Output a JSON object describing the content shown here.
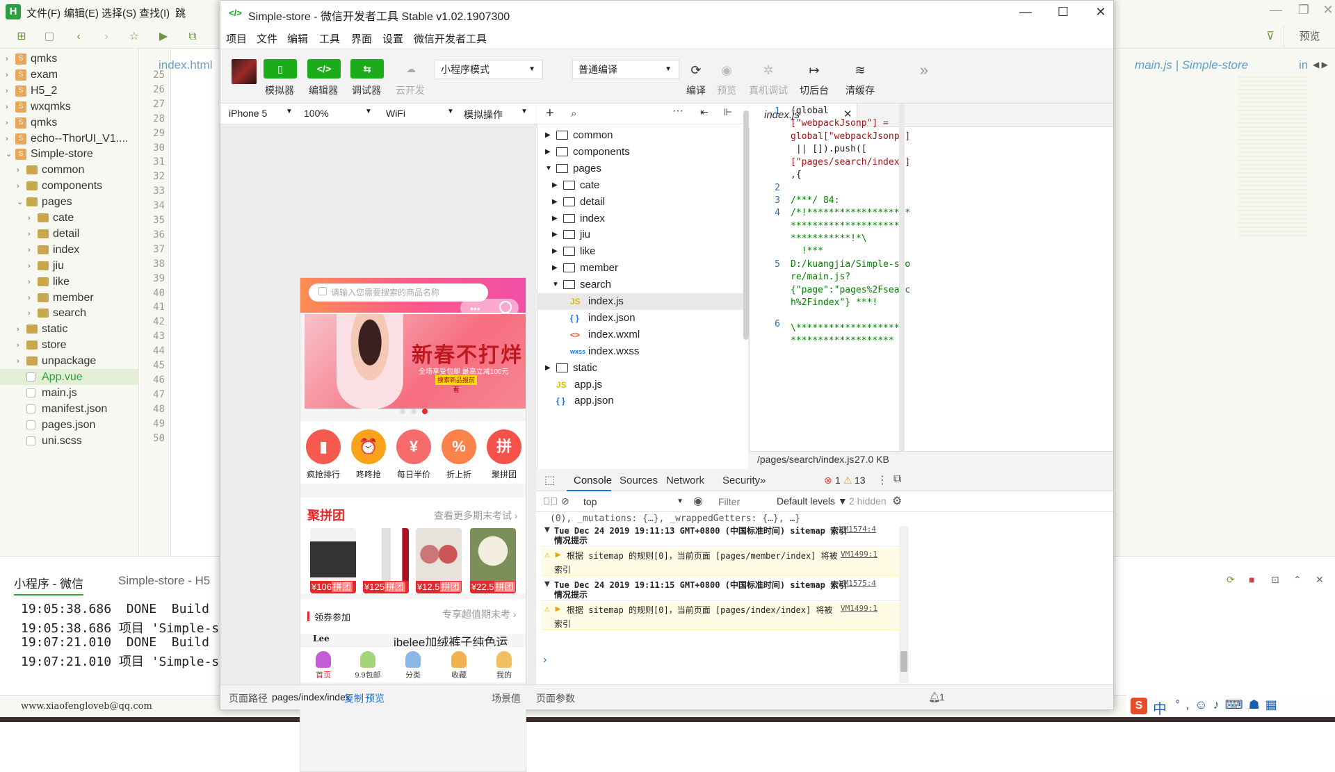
{
  "hbuilder": {
    "menus": [
      "文件(F)",
      "编辑(E)",
      "选择(S)",
      "查找(I)",
      "跳"
    ],
    "preview_label": "预览",
    "tab_index": "index.html",
    "right_tab": "main.js | Simple-store",
    "right_tab_extra": "in",
    "tree": [
      {
        "label": "qmks",
        "level": 0,
        "type": "project",
        "expanded": false
      },
      {
        "label": "exam",
        "level": 0,
        "type": "project",
        "expanded": false
      },
      {
        "label": "H5_2",
        "level": 0,
        "type": "project",
        "expanded": false
      },
      {
        "label": "wxqmks",
        "level": 0,
        "type": "project",
        "expanded": false
      },
      {
        "label": "qmks",
        "level": 0,
        "type": "project",
        "expanded": false
      },
      {
        "label": "echo--ThorUI_V1....",
        "level": 0,
        "type": "project",
        "expanded": false
      },
      {
        "label": "Simple-store",
        "level": 0,
        "type": "project",
        "expanded": true
      },
      {
        "label": "common",
        "level": 1,
        "type": "folder",
        "expanded": false
      },
      {
        "label": "components",
        "level": 1,
        "type": "folder",
        "expanded": false
      },
      {
        "label": "pages",
        "level": 1,
        "type": "folder",
        "expanded": true
      },
      {
        "label": "cate",
        "level": 2,
        "type": "folder",
        "expanded": false
      },
      {
        "label": "detail",
        "level": 2,
        "type": "folder",
        "expanded": false
      },
      {
        "label": "index",
        "level": 2,
        "type": "folder",
        "expanded": false
      },
      {
        "label": "jiu",
        "level": 2,
        "type": "folder",
        "expanded": false
      },
      {
        "label": "like",
        "level": 2,
        "type": "folder",
        "expanded": false
      },
      {
        "label": "member",
        "level": 2,
        "type": "folder",
        "expanded": false
      },
      {
        "label": "search",
        "level": 2,
        "type": "folder",
        "expanded": false
      },
      {
        "label": "static",
        "level": 1,
        "type": "folder",
        "expanded": false
      },
      {
        "label": "store",
        "level": 1,
        "type": "folder",
        "expanded": false
      },
      {
        "label": "unpackage",
        "level": 1,
        "type": "folder",
        "expanded": false
      },
      {
        "label": "App.vue",
        "level": 1,
        "type": "file",
        "selected": true
      },
      {
        "label": "main.js",
        "level": 1,
        "type": "file"
      },
      {
        "label": "manifest.json",
        "level": 1,
        "type": "file"
      },
      {
        "label": "pages.json",
        "level": 1,
        "type": "file"
      },
      {
        "label": "uni.scss",
        "level": 1,
        "type": "file"
      }
    ],
    "line_numbers": [
      "25",
      "26",
      "27",
      "28",
      "29",
      "30",
      "31",
      "32",
      "33",
      "34",
      "35",
      "36",
      "37",
      "38",
      "39",
      "40",
      "41",
      "42",
      "43",
      "44",
      "45",
      "46",
      "47",
      "48",
      "49",
      "50"
    ],
    "console_tabs": [
      "小程序 - 微信",
      "Simple-store - H5"
    ],
    "console_lines": [
      "19:05:38.686  DONE  Build",
      "19:05:38.686 项目 'Simple-s",
      "19:07:21.010  DONE  Build",
      "19:07:21.010 项目 'Simple-s"
    ],
    "status_email": "www.xiaofengloveb@qq.com"
  },
  "wechat": {
    "title": "Simple-store - 微信开发者工具 Stable v1.02.1907300",
    "menus": [
      "项目",
      "文件",
      "编辑",
      "工具",
      "界面",
      "设置",
      "微信开发者工具"
    ],
    "toolbar": {
      "simulator": "模拟器",
      "editor": "编辑器",
      "debugger": "调试器",
      "cloud": "云开发",
      "mode_select": "小程序模式",
      "compile_select": "普通编译",
      "compile": "编译",
      "preview": "预览",
      "remote_debug": "真机调试",
      "background": "切后台",
      "clear_cache": "清缓存",
      "simulator_icon_text": "▯",
      "editor_icon_text": "</>",
      "debugger_icon_text": "⇆"
    },
    "sim_bar": {
      "device": "iPhone 5",
      "zoom": "100%",
      "network": "WiFi",
      "operation": "模拟操作"
    },
    "phone": {
      "search_placeholder": "请输入您需要搜索的商品名称",
      "banner_title": "新春不打烊",
      "banner_sub": "全场享受包邮 最高立减100元",
      "banner_btn": "搜索新品报前看",
      "categories": [
        {
          "label": "疯抢排行",
          "glyph": "▮",
          "color": "#f55a4e"
        },
        {
          "label": "咚咚抢",
          "glyph": "⏰",
          "color": "#f9a21a"
        },
        {
          "label": "每日半价",
          "glyph": "¥",
          "color": "#f66b6b"
        },
        {
          "label": "折上折",
          "glyph": "%",
          "color": "#f9834a"
        },
        {
          "label": "聚拼团",
          "glyph": "拼",
          "color": "#f5524a"
        }
      ],
      "group_title": "聚拼团",
      "group_more": "查看更多期末考试 ›",
      "products": [
        {
          "price": "¥106",
          "tag": "拼团"
        },
        {
          "price": "¥125",
          "tag": "拼团"
        },
        {
          "price": "¥12.5",
          "tag": "拼团"
        },
        {
          "price": "¥22.5",
          "tag": "拼团"
        }
      ],
      "coupon_title": "领券参加",
      "coupon_more": "专享超值期末考 ›",
      "item_title": "ibelee加绒裤子纯色运",
      "tabbar": [
        "首页",
        "9.9包邮",
        "分类",
        "收藏",
        "我的"
      ]
    },
    "path_bar": {
      "label": "页面路径",
      "path": "pages/index/index",
      "copy": "复制",
      "preview": "预览",
      "scene": "场景值",
      "params": "页面参数"
    },
    "file_tree": [
      {
        "label": "common",
        "level": 0,
        "type": "folder",
        "expanded": false
      },
      {
        "label": "components",
        "level": 0,
        "type": "folder",
        "expanded": false
      },
      {
        "label": "pages",
        "level": 0,
        "type": "folder",
        "expanded": true
      },
      {
        "label": "cate",
        "level": 1,
        "type": "folder",
        "expanded": false
      },
      {
        "label": "detail",
        "level": 1,
        "type": "folder",
        "expanded": false
      },
      {
        "label": "index",
        "level": 1,
        "type": "folder",
        "expanded": false
      },
      {
        "label": "jiu",
        "level": 1,
        "type": "folder",
        "expanded": false
      },
      {
        "label": "like",
        "level": 1,
        "type": "folder",
        "expanded": false
      },
      {
        "label": "member",
        "level": 1,
        "type": "folder",
        "expanded": false
      },
      {
        "label": "search",
        "level": 1,
        "type": "folder",
        "expanded": true
      },
      {
        "label": "index.js",
        "level": 2,
        "type": "js",
        "selected": true
      },
      {
        "label": "index.json",
        "level": 2,
        "type": "json"
      },
      {
        "label": "index.wxml",
        "level": 2,
        "type": "wxml"
      },
      {
        "label": "index.wxss",
        "level": 2,
        "type": "wxss"
      },
      {
        "label": "static",
        "level": 0,
        "type": "folder",
        "expanded": false
      },
      {
        "label": "app.js",
        "level": 0,
        "type": "js"
      },
      {
        "label": "app.json",
        "level": 0,
        "type": "json"
      }
    ],
    "editor": {
      "tab": "index.js",
      "file_path": "/pages/search/index.js",
      "file_size": "27.0 KB",
      "line_numbers": [
        "1",
        "2",
        "3",
        "4",
        "5",
        "6"
      ],
      "code": [
        "(global",
        "[\"webpackJsonp\"] =",
        "global[\"webpackJsonp\"]",
        " || []).push([",
        "[\"pages/search/index\"]",
        ",{",
        "",
        "/***/ 84:",
        "/*!*******************",
        "*********************",
        "***********!*\\",
        "  !***",
        "D:/kuangjia/Simple-sto",
        "re/main.js?",
        "{\"page\":\"pages%2Fsearc",
        "h%2Findex\"} ***!",
        "",
        "\\*******************",
        "*******************"
      ]
    },
    "devtools": {
      "tabs": [
        "Console",
        "Sources",
        "Network",
        "Security",
        "»"
      ],
      "errors": "1",
      "warnings": "13",
      "context": "top",
      "filter_placeholder": "Filter",
      "levels": "Default levels ▼",
      "hidden": "2 hidden",
      "truncated": "(0), _mutations: {…}, _wrappedGetters: {…}, …}",
      "messages": [
        {
          "kind": "group",
          "text": "Tue Dec 24 2019 19:11:13 GMT+0800 (中国标准时间) sitemap 索引",
          "text2": "情况提示",
          "link": "VM1574:4"
        },
        {
          "kind": "warn",
          "text": "根据 sitemap 的规则[0]，当前页面 [pages/member/index] 将被",
          "text2": "索引",
          "link": "VM1499:1"
        },
        {
          "kind": "group",
          "text": "Tue Dec 24 2019 19:11:15 GMT+0800 (中国标准时间) sitemap 索引",
          "text2": "情况提示",
          "link": "VM1575:4"
        },
        {
          "kind": "warn",
          "text": "根据 sitemap 的规则[0]，当前页面 [pages/index/index] 将被",
          "text2": "索引",
          "link": "VM1499:1"
        }
      ],
      "prompt": "›",
      "notification_count": "1"
    }
  },
  "ime": {
    "label": "中"
  },
  "colors": {
    "accent_green": "#1aad19",
    "hb_green": "#2ea042",
    "price_red": "#e8262d",
    "link_blue": "#1a73e8"
  }
}
